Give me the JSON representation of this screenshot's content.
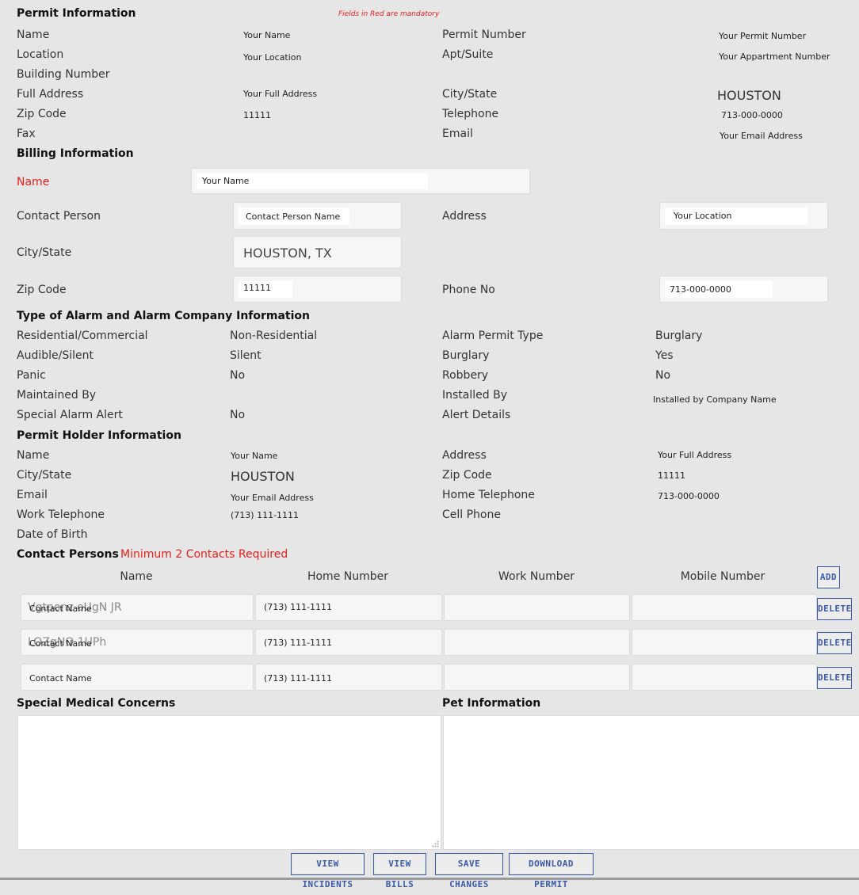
{
  "permit": {
    "title": "Permit Information",
    "mandatory_note": "Fields in Red are mandatory",
    "name_label": "Name",
    "name_value": "Your Name",
    "permit_number_label": "Permit Number",
    "permit_number_value": "Your Permit Number",
    "location_label": "Location",
    "location_value": "Your Location",
    "apt_label": "Apt/Suite",
    "apt_value": "Your Appartment Number",
    "building_label": "Building Number",
    "full_address_label": "Full Address",
    "full_address_value": "Your Full Address",
    "city_state_label": "City/State",
    "city_state_value": "HOUSTON",
    "zip_label": "Zip Code",
    "zip_value": "11111",
    "telephone_label": "Telephone",
    "telephone_value": "713-000-0000",
    "fax_label": "Fax",
    "email_label": "Email",
    "email_value": "Your Email Address"
  },
  "billing": {
    "title": "Billing Information",
    "name_label": "Name",
    "name_value": "Your Name",
    "contact_label": "Contact Person",
    "contact_value": "Contact Person Name",
    "address_label": "Address",
    "address_value": "Your Location",
    "city_state_label": "City/State",
    "city_state_value": "HOUSTON, TX",
    "zip_label": "Zip Code",
    "zip_value": "11111",
    "phone_label": "Phone No",
    "phone_value": "713-000-0000"
  },
  "alarm": {
    "title": "Type of Alarm and Alarm Company Information",
    "res_label": "Residential/Commercial",
    "res_value": "Non-Residential",
    "permit_type_label": "Alarm Permit Type",
    "permit_type_value": "Burglary",
    "audible_label": "Audible/Silent",
    "audible_value": "Silent",
    "burglary_label": "Burglary",
    "burglary_value": "Yes",
    "panic_label": "Panic",
    "panic_value": "No",
    "robbery_label": "Robbery",
    "robbery_value": "No",
    "maintained_label": "Maintained By",
    "installed_label": "Installed By",
    "installed_value": "Installed by Company Name",
    "special_label": "Special Alarm Alert",
    "special_value": "No",
    "alert_details_label": "Alert Details"
  },
  "holder": {
    "title": "Permit Holder Information",
    "name_label": "Name",
    "name_value": "Your Name",
    "address_label": "Address",
    "address_value": "Your Full Address",
    "city_state_label": "City/State",
    "city_state_value": "HOUSTON",
    "zip_label": "Zip Code",
    "zip_value": "11111",
    "email_label": "Email",
    "email_value": "Your Email Address",
    "home_tel_label": "Home Telephone",
    "home_tel_value": "713-000-0000",
    "work_tel_label": "Work Telephone",
    "work_tel_value": "(713) 111-1111",
    "cell_label": "Cell Phone",
    "dob_label": "Date of Birth"
  },
  "contacts": {
    "title": "Contact Persons",
    "required_note": "Minimum  2 Contacts Required",
    "columns": {
      "name": "Name",
      "home": "Home Number",
      "work": "Work Number",
      "mobile": "Mobile Number"
    },
    "add_label": "ADD",
    "delete_label": "DELETE",
    "rows": [
      {
        "name": "Contact Name",
        "ghost": "Vgtponz oUgN JR",
        "home": "(713) 111-1111",
        "work": "",
        "mobile": ""
      },
      {
        "name": "Contact Name",
        "ghost": "LOZgNO 1UPh",
        "home": "(713) 111-1111",
        "work": "",
        "mobile": ""
      },
      {
        "name": "Contact Name",
        "ghost": "",
        "home": "(713) 111-1111",
        "work": "",
        "mobile": ""
      }
    ]
  },
  "medical": {
    "title": "Special Medical Concerns",
    "value": ""
  },
  "pet": {
    "title": "Pet Information",
    "value": ""
  },
  "actions": {
    "view_incidents": "VIEW INCIDENTS",
    "view_bills": "VIEW BILLS",
    "save_changes": "SAVE CHANGES",
    "download_permit": "DOWNLOAD PERMIT"
  },
  "colors": {
    "background": "#e6e6e6",
    "mandatory_red": "#e5201c",
    "button_blue": "#3b5aa8"
  }
}
